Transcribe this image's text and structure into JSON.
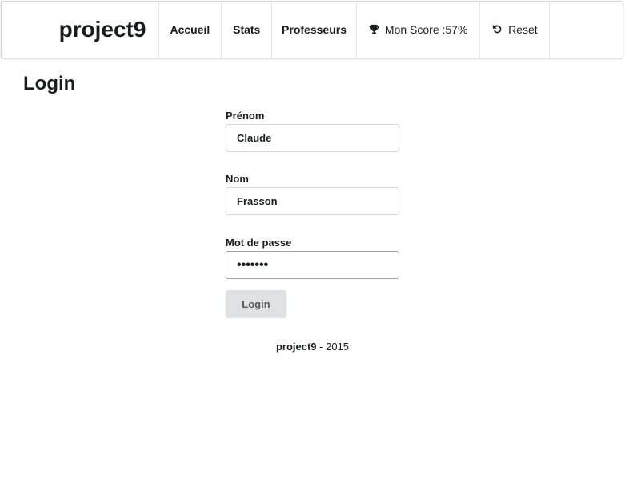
{
  "nav": {
    "brand": "project9",
    "items": [
      {
        "label": "Accueil"
      },
      {
        "label": "Stats"
      },
      {
        "label": "Professeurs"
      }
    ],
    "score": {
      "label": "Mon Score :",
      "value": "57%",
      "icon": "trophy-icon"
    },
    "reset": {
      "label": "Reset",
      "icon": "undo-icon"
    }
  },
  "page": {
    "title": "Login"
  },
  "form": {
    "first_name": {
      "label": "Prénom",
      "value": "Claude"
    },
    "last_name": {
      "label": "Nom",
      "value": "Frasson"
    },
    "password": {
      "label": "Mot de passe",
      "value": "•••••••"
    },
    "submit_label": "Login"
  },
  "footer": {
    "brand": "project9",
    "separator": " - ",
    "year": "2015"
  }
}
